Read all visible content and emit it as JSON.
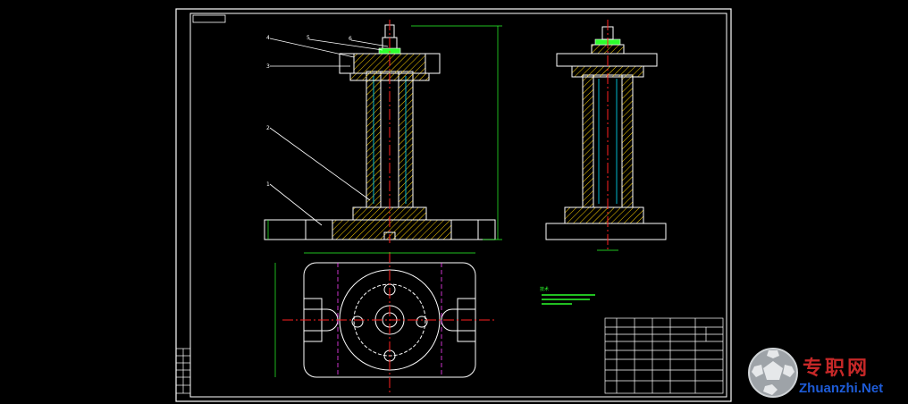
{
  "drawing": {
    "part_callouts": [
      "4",
      "5",
      "6",
      "3",
      "2",
      "1"
    ],
    "tech_notes_heading": "技术",
    "colors": {
      "background": "#000000",
      "outline": "#ffffff",
      "hatch": "#ffd200",
      "centerline": "#ff2020",
      "dimension": "#2cff2c",
      "hidden": "#ff40ff",
      "detail": "#00e5ff"
    }
  },
  "watermark": {
    "cn_text": "专职网",
    "en_text": "Zhuanzhi.Net",
    "logo_icon": "soccer-ball-icon"
  }
}
